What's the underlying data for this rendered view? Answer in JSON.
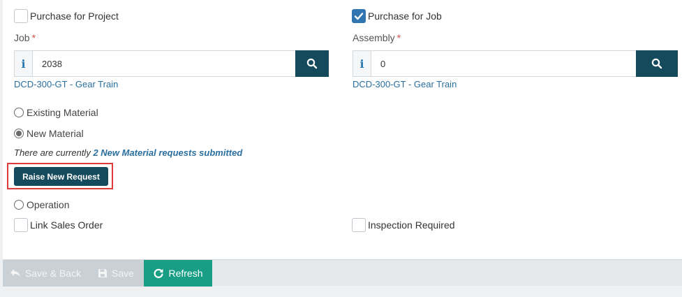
{
  "form": {
    "purchase_for_project": {
      "label": "Purchase for Project",
      "checked": false
    },
    "purchase_for_job": {
      "label": "Purchase for Job",
      "checked": true
    },
    "job": {
      "label": "Job",
      "required_mark": "*",
      "info_glyph": "i",
      "value": "2038",
      "link": "DCD-300-GT - Gear Train"
    },
    "assembly": {
      "label": "Assembly",
      "required_mark": "*",
      "info_glyph": "i",
      "value": "0",
      "link": "DCD-300-GT - Gear Train"
    },
    "material_options": [
      {
        "label": "Existing Material",
        "selected": false
      },
      {
        "label": "New Material",
        "selected": true
      }
    ],
    "notice": {
      "prefix": "There are currently ",
      "link": "2 New Material requests submitted"
    },
    "raise_button": "Raise New Request",
    "operation": {
      "label": "Operation",
      "selected": false
    },
    "link_sales_order": {
      "label": "Link Sales Order",
      "checked": false
    },
    "inspection_required": {
      "label": "Inspection Required",
      "checked": false
    }
  },
  "footer": {
    "save_back": "Save & Back",
    "save": "Save",
    "refresh": "Refresh"
  },
  "colors": {
    "primary_dark": "#154a5c",
    "accent_green": "#179e85",
    "checkbox_blue": "#3276b1",
    "link_blue": "#2a6fa0",
    "highlight_red": "#e03b3b"
  },
  "icons": {
    "search": "search-icon",
    "info": "info-icon",
    "check": "check-icon",
    "save_back": "reply-arrow-icon",
    "save": "floppy-disk-icon",
    "refresh": "refresh-icon"
  }
}
